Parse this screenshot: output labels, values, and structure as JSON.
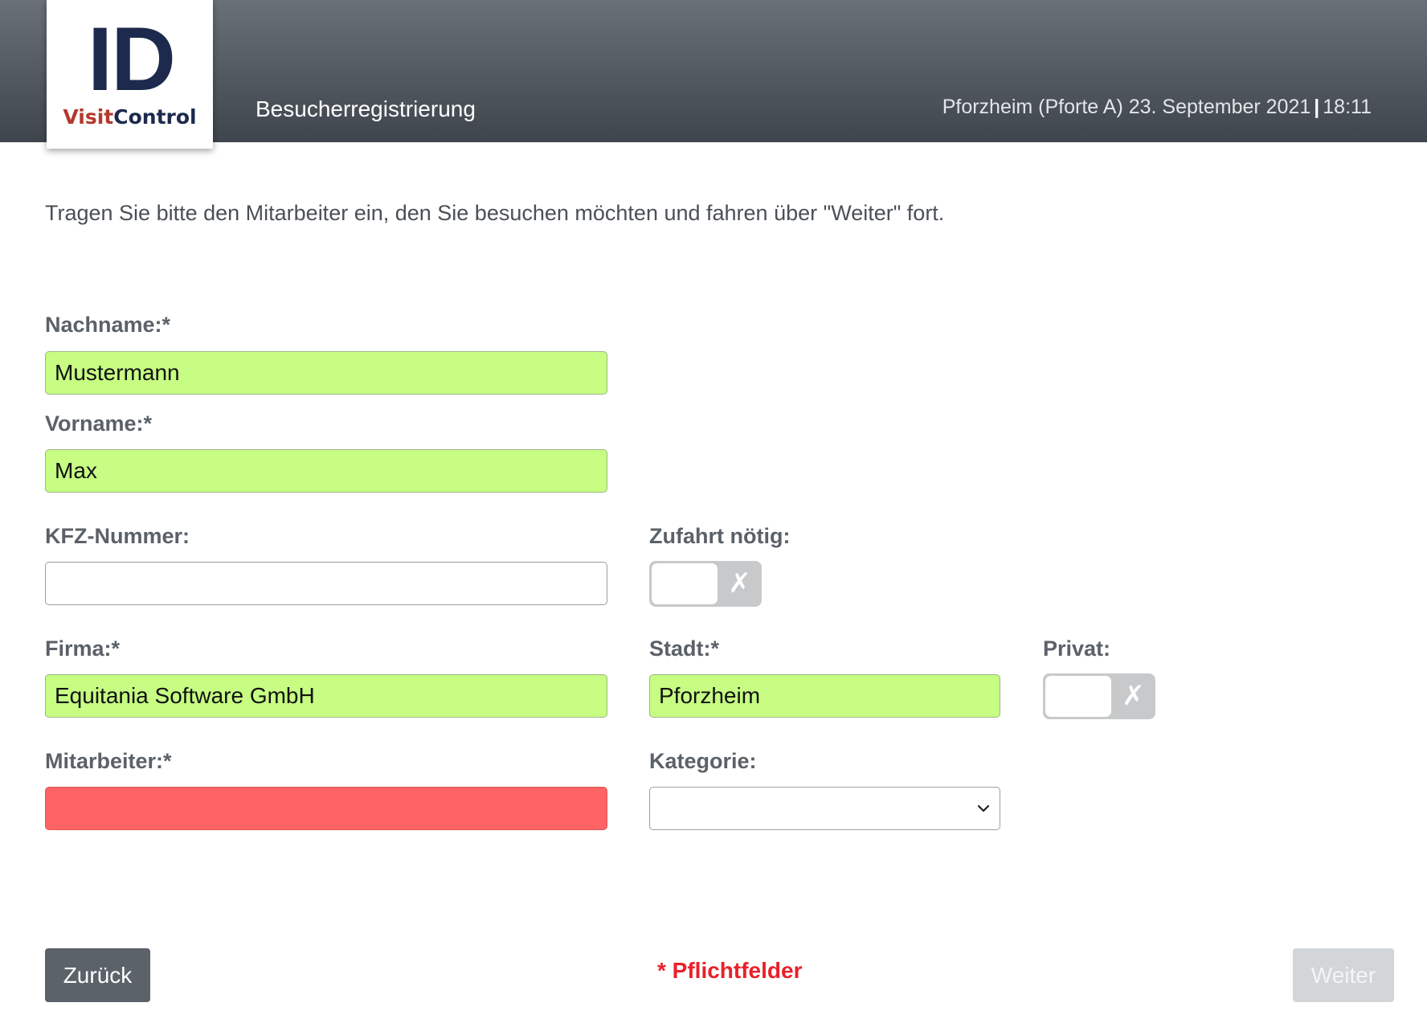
{
  "header": {
    "logo": {
      "mark": "ID",
      "brand_part1": "Visit",
      "brand_part2": "Control"
    },
    "title": "Besucherregistrierung",
    "location": "Pforzheim (Pforte A) 23. September 2021",
    "separator": "|",
    "time": "18:11"
  },
  "instruction": "Tragen Sie bitte den Mitarbeiter ein, den Sie besuchen möchten und fahren über \"Weiter\" fort.",
  "form": {
    "nachname": {
      "label": "Nachname:*",
      "value": "Mustermann",
      "state": "valid"
    },
    "vorname": {
      "label": "Vorname:*",
      "value": "Max",
      "state": "valid"
    },
    "kfz": {
      "label": "KFZ-Nummer:",
      "value": "",
      "state": "empty"
    },
    "zufahrt": {
      "label": "Zufahrt nötig:",
      "checked": false,
      "icon": "x-mark-icon",
      "mark": "✗"
    },
    "firma": {
      "label": "Firma:*",
      "value": "Equitania Software GmbH",
      "state": "valid"
    },
    "stadt": {
      "label": "Stadt:*",
      "value": "Pforzheim",
      "state": "valid"
    },
    "privat": {
      "label": "Privat:",
      "checked": false,
      "icon": "x-mark-icon",
      "mark": "✗"
    },
    "mitarbeiter": {
      "label": "Mitarbeiter:*",
      "value": "",
      "state": "invalid"
    },
    "kategorie": {
      "label": "Kategorie:",
      "selected": "",
      "icon": "chevron-down-icon"
    }
  },
  "footer": {
    "back_label": "Zurück",
    "next_label": "Weiter",
    "required_note": "* Pflichtfelder"
  },
  "colors": {
    "header_dark": "#3f454d",
    "valid_field": "#c6fd82",
    "invalid_field": "#ff6363",
    "required_text": "#e8212a",
    "back_button": "#5b6269",
    "next_button_disabled": "#d3d6d9",
    "logo_navy": "#1d2a4d",
    "logo_red": "#b3392c"
  }
}
